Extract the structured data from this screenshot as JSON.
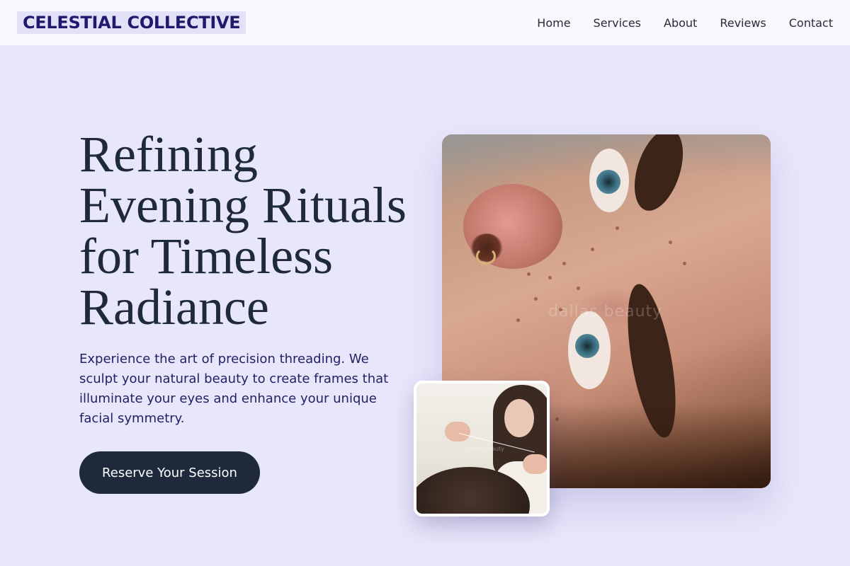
{
  "header": {
    "brand": "CELESTIAL COLLECTIVE",
    "nav": [
      "Home",
      "Services",
      "About",
      "Reviews",
      "Contact"
    ]
  },
  "hero": {
    "title": "Refining Evening Rituals for Timeless Radiance",
    "description": "Experience the art of precision threading. We sculpt your natural beauty to create frames that illuminate your eyes and enhance your unique facial symmetry.",
    "cta_label": "Reserve Your Session"
  },
  "images": {
    "main_watermark": "dallas beauty",
    "inset_watermark": "dallas beauty"
  },
  "colors": {
    "page_background": "#e8e6fa",
    "header_background": "#f8f8fe",
    "brand_text": "#1e1b6e",
    "brand_highlight": "#e3e1f7",
    "title_text": "#1e293b",
    "body_text": "#232066",
    "button_background": "#1e293b",
    "button_text": "#ffffff"
  }
}
